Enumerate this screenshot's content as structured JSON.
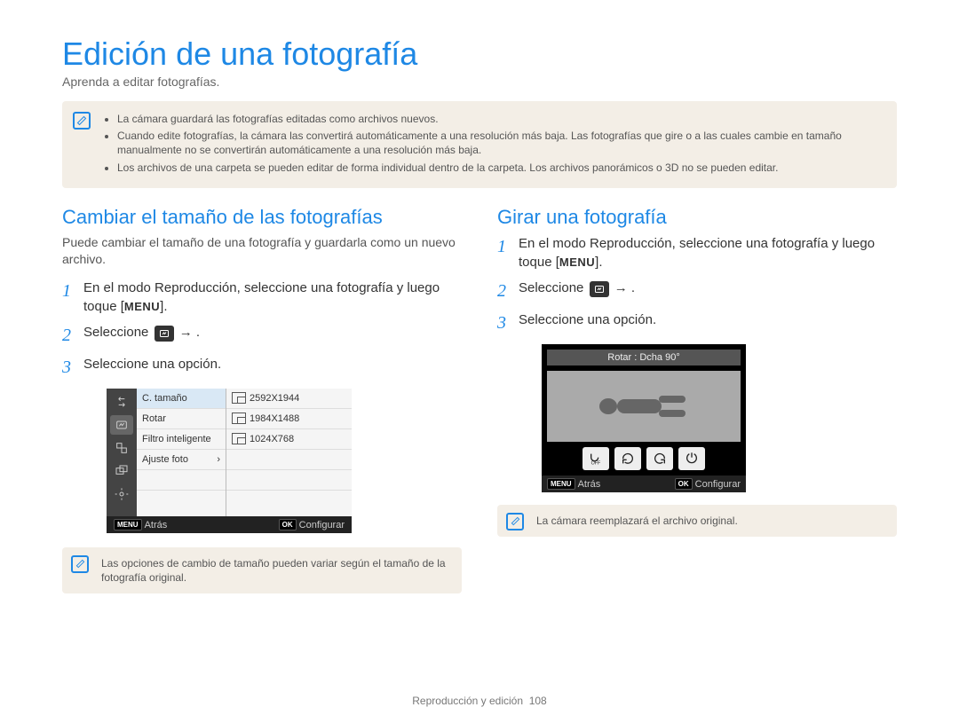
{
  "title": "Edición de una fotografía",
  "subtitle": "Aprenda a editar fotografías.",
  "callout": {
    "items": [
      "La cámara guardará las fotografías editadas como archivos nuevos.",
      "Cuando edite fotografías, la cámara las convertirá automáticamente a una resolución más baja. Las fotografías que gire o a las cuales cambie en tamaño manualmente no se convertirán automáticamente a una resolución más baja.",
      "Los archivos de una carpeta se pueden editar de forma individual dentro de la carpeta. Los archivos panorámicos o 3D no se pueden editar."
    ]
  },
  "left": {
    "heading": "Cambiar el tamaño de las fotografías",
    "lead": "Puede cambiar el tamaño de una fotografía y guardarla como un nuevo archivo.",
    "step1_a": "En el modo Reproducción, seleccione una fotografía y luego toque [",
    "menu_label": "MENU",
    "step1_b": "].",
    "step2_a": "Seleccione ",
    "step2_b": " →    .",
    "step3": "Seleccione una opción.",
    "screen": {
      "menu": {
        "items": [
          "C. tamaño",
          "Rotar",
          "Filtro inteligente",
          "Ajuste foto"
        ],
        "selected_index": 0
      },
      "sizes": [
        "2592X1944",
        "1984X1488",
        "1024X768"
      ],
      "footer_back": "Atrás",
      "footer_back_badge": "MENU",
      "footer_ok": "Configurar",
      "footer_ok_badge": "OK"
    },
    "note": "Las opciones de cambio de tamaño pueden variar según el tamaño de la fotografía original."
  },
  "right": {
    "heading": "Girar una fotografía",
    "step1_a": "En el modo Reproducción, seleccione una fotografía y luego toque [",
    "menu_label": "MENU",
    "step1_b": "].",
    "step2_a": "Seleccione ",
    "step2_b": " →    .",
    "step3": "Seleccione una opción.",
    "screen": {
      "header": "Rotar : Dcha 90°",
      "icons": [
        "off",
        "rotate-cw",
        "rotate-ccw",
        "rotate-180"
      ],
      "footer_back": "Atrás",
      "footer_back_badge": "MENU",
      "footer_ok": "Configurar",
      "footer_ok_badge": "OK"
    },
    "note": "La cámara reemplazará el archivo original."
  },
  "footer": {
    "section": "Reproducción y edición",
    "page": "108"
  }
}
